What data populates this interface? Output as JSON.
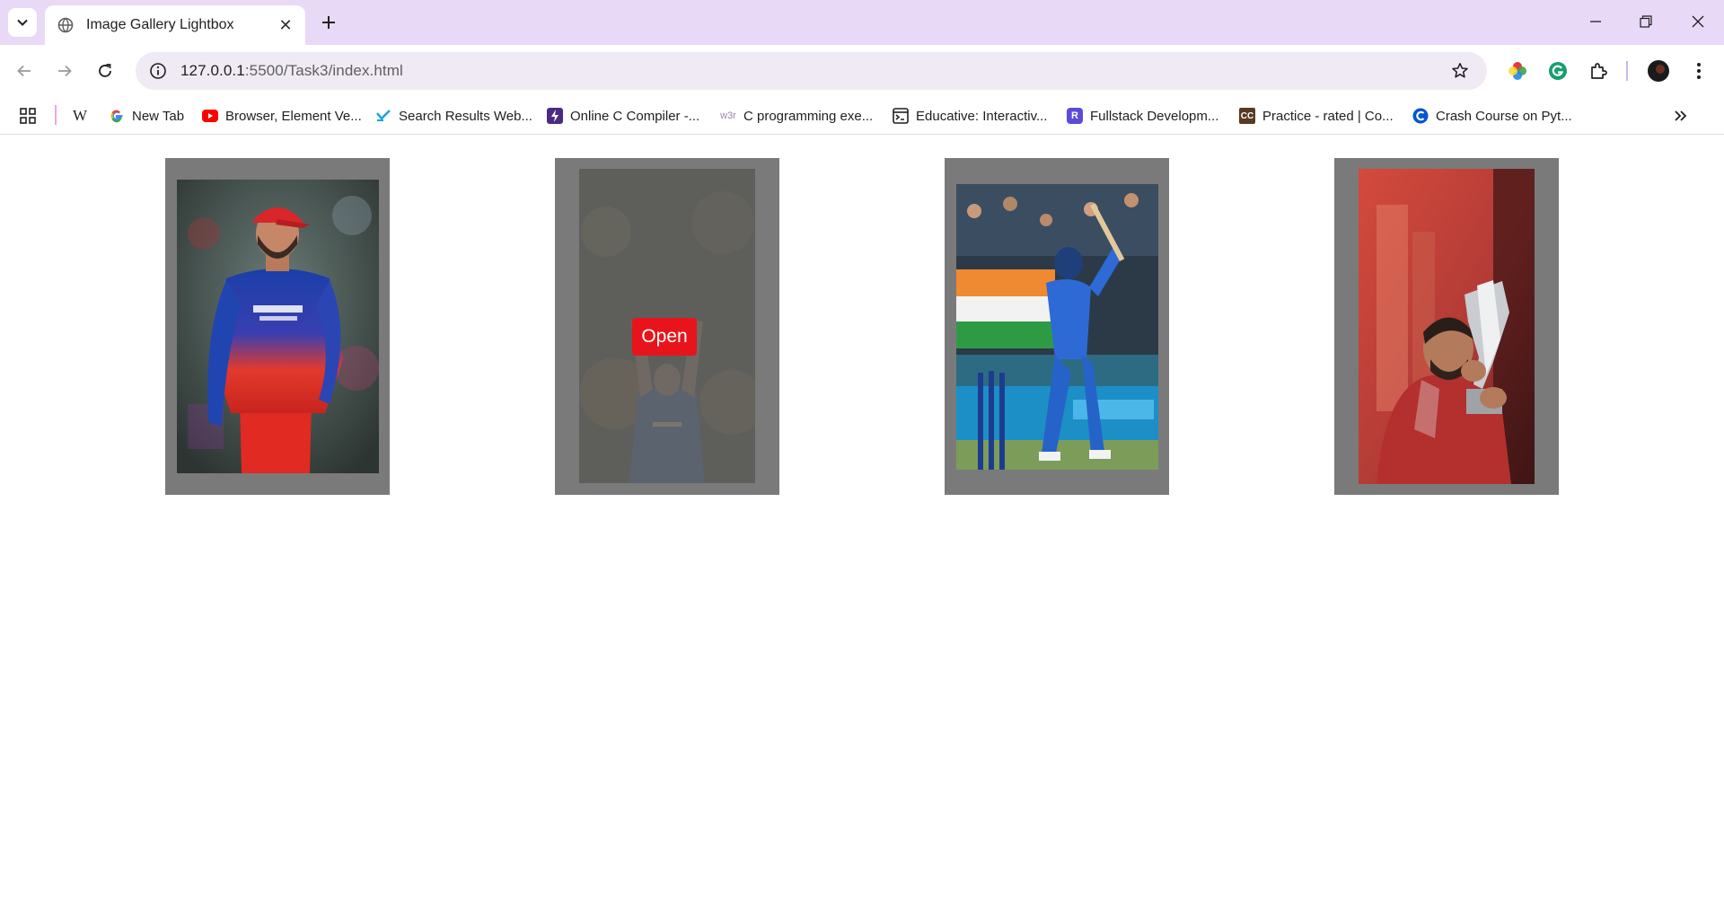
{
  "browser": {
    "tab": {
      "title": "Image Gallery Lightbox"
    },
    "address_bar": {
      "url_host": "127.0.0.1",
      "url_rest": ":5500/Task3/index.html"
    }
  },
  "bookmarks": [
    {
      "label": "",
      "icon": "wikipedia-icon"
    },
    {
      "label": "New Tab",
      "icon": "google-icon"
    },
    {
      "label": "Browser, Element Ve...",
      "icon": "youtube-icon"
    },
    {
      "label": "Search Results Web...",
      "icon": "check-icon"
    },
    {
      "label": "Online C Compiler -...",
      "icon": "bolt-icon"
    },
    {
      "label": "C programming exe...",
      "icon": "w3r-icon"
    },
    {
      "label": "Educative: Interactiv...",
      "icon": "educative-icon"
    },
    {
      "label": "Fullstack Developm...",
      "icon": "r-icon"
    },
    {
      "label": "Practice - rated | Co...",
      "icon": "cc-icon"
    },
    {
      "label": "Crash Course on Pyt...",
      "icon": "coursera-icon"
    }
  ],
  "gallery": {
    "open_button_label": "Open",
    "images": [
      {
        "alt": "player-portrait-red-kit"
      },
      {
        "alt": "player-celebration-hovered"
      },
      {
        "alt": "player-batting-shot"
      },
      {
        "alt": "player-kissing-trophy"
      }
    ]
  },
  "colors": {
    "titlebar": "#e8d9f7",
    "card_frame": "#7a7a7a",
    "open_button": "#e8141c"
  }
}
